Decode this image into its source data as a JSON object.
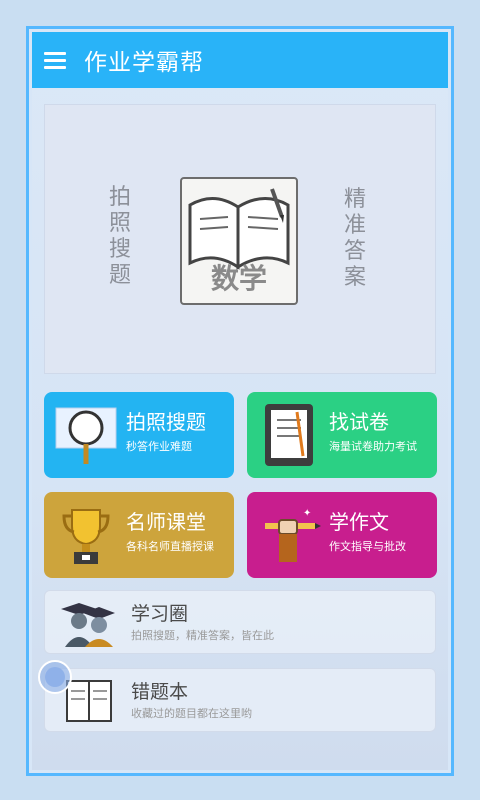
{
  "app": {
    "title": "作业学霸帮",
    "menu_icon": "menu-icon"
  },
  "banner": {
    "left_text": [
      "拍",
      "照",
      "搜",
      "题"
    ],
    "right_text": [
      "精",
      "准",
      "答",
      "案"
    ],
    "book_label": "数学",
    "book_icon": "open-book-icon"
  },
  "cards": [
    {
      "title": "拍照搜题",
      "subtitle": "秒答作业难题",
      "icon": "magnifier-icon",
      "color": "#23b4f2"
    },
    {
      "title": "找试卷",
      "subtitle": "海量试卷助力考试",
      "icon": "tablet-doc-icon",
      "color": "#2bd084"
    },
    {
      "title": "名师课堂",
      "subtitle": "各科名师直播授课",
      "icon": "trophy-icon",
      "color": "#cda43c"
    },
    {
      "title": "学作文",
      "subtitle": "作文指导与批改",
      "icon": "hand-pencil-icon",
      "color": "#c81e8e"
    }
  ],
  "rows": [
    {
      "title": "学习圈",
      "subtitle": "拍照搜题，精准答案，皆在此",
      "icon": "graduates-icon"
    },
    {
      "title": "错题本",
      "subtitle": "收藏过的题目都在这里哟",
      "icon": "notebook-icon"
    }
  ]
}
